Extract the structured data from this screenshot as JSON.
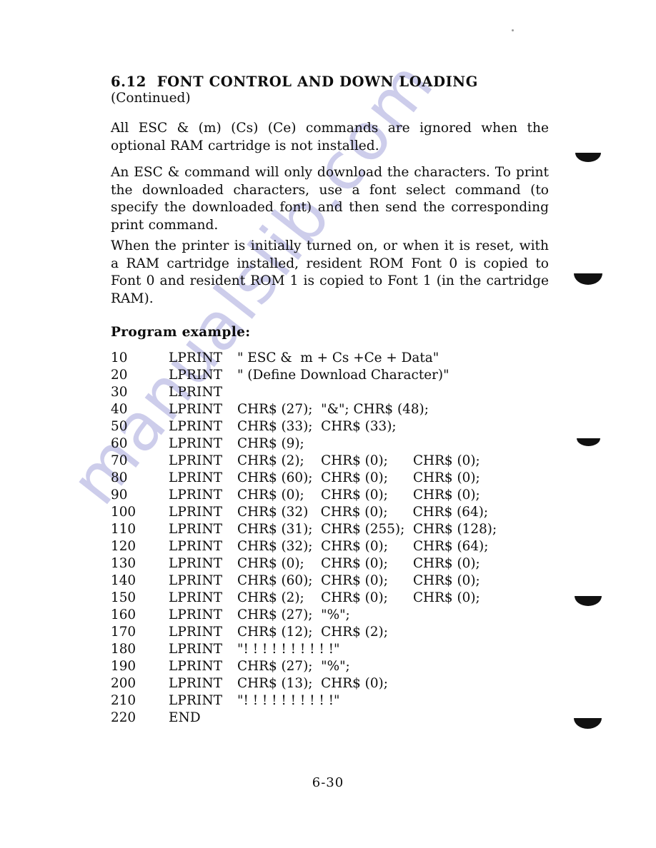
{
  "document": {
    "heading": {
      "section_number": "6.12",
      "title": "FONT CONTROL AND DOWN LOADING",
      "continued_label": "(Continued)"
    },
    "paragraphs": [
      "All ESC & (m) (Cs) (Ce) commands are ignored when the optional RAM cartridge is not installed.",
      "An ESC & command will only download the characters. To print the downloaded characters, use a font select command (to specify the downloaded font) and then send the corresponding print command.",
      "When the printer is initially turned on, or when it is reset, with a RAM cartridge installed, resident ROM Font 0 is copied to Font 0 and resident ROM 1 is copied to Font 1 (in the cartridge RAM)."
    ],
    "program_example_label": "Program example:",
    "program_lines": [
      {
        "number": "10",
        "keyword": "LPRINT",
        "args": "\" ESC &  m + Cs +Ce + Data\""
      },
      {
        "number": "20",
        "keyword": "LPRINT",
        "args": "\" (Define Download Character)\""
      },
      {
        "number": "30",
        "keyword": "LPRINT",
        "args": ""
      },
      {
        "number": "40",
        "keyword": "LPRINT",
        "args": "CHR$ (27);  \"&\"; CHR$ (48);"
      },
      {
        "number": "50",
        "keyword": "LPRINT",
        "args": "CHR$ (33);  CHR$ (33);"
      },
      {
        "number": "60",
        "keyword": "LPRINT",
        "args": "CHR$ (9);"
      },
      {
        "number": "70",
        "keyword": "LPRINT",
        "args": "CHR$ (2);    CHR$ (0);      CHR$ (0);"
      },
      {
        "number": "80",
        "keyword": "LPRINT",
        "args": "CHR$ (60);  CHR$ (0);      CHR$ (0);"
      },
      {
        "number": "90",
        "keyword": "LPRINT",
        "args": "CHR$ (0);    CHR$ (0);      CHR$ (0);"
      },
      {
        "number": "100",
        "keyword": "LPRINT",
        "args": "CHR$ (32)   CHR$ (0);      CHR$ (64);"
      },
      {
        "number": "110",
        "keyword": "LPRINT",
        "args": "CHR$ (31);  CHR$ (255);  CHR$ (128);"
      },
      {
        "number": "120",
        "keyword": "LPRINT",
        "args": "CHR$ (32);  CHR$ (0);      CHR$ (64);"
      },
      {
        "number": "130",
        "keyword": "LPRINT",
        "args": "CHR$ (0);    CHR$ (0);      CHR$ (0);"
      },
      {
        "number": "140",
        "keyword": "LPRINT",
        "args": "CHR$ (60);  CHR$ (0);      CHR$ (0);"
      },
      {
        "number": "150",
        "keyword": "LPRINT",
        "args": "CHR$ (2);    CHR$ (0);      CHR$ (0);"
      },
      {
        "number": "160",
        "keyword": "LPRINT",
        "args": "CHR$ (27);  \"%\";"
      },
      {
        "number": "170",
        "keyword": "LPRINT",
        "args": "CHR$ (12);  CHR$ (2);"
      },
      {
        "number": "180",
        "keyword": "LPRINT",
        "args": "\"! ! ! ! ! ! ! ! ! !\""
      },
      {
        "number": "190",
        "keyword": "LPRINT",
        "args": "CHR$ (27);  \"%\";"
      },
      {
        "number": "200",
        "keyword": "LPRINT",
        "args": "CHR$ (13);  CHR$ (0);"
      },
      {
        "number": "210",
        "keyword": "LPRINT",
        "args": "\"! ! ! ! ! ! ! ! ! !\""
      },
      {
        "number": "220",
        "keyword": "END",
        "args": ""
      }
    ],
    "page_number": "6-30",
    "watermark": {
      "text": "manualslib.com",
      "color": "#cdcdeb"
    },
    "colors": {
      "page_background": "#ffffff",
      "ink": "#0d0d0d",
      "artifact": "#111111"
    }
  }
}
